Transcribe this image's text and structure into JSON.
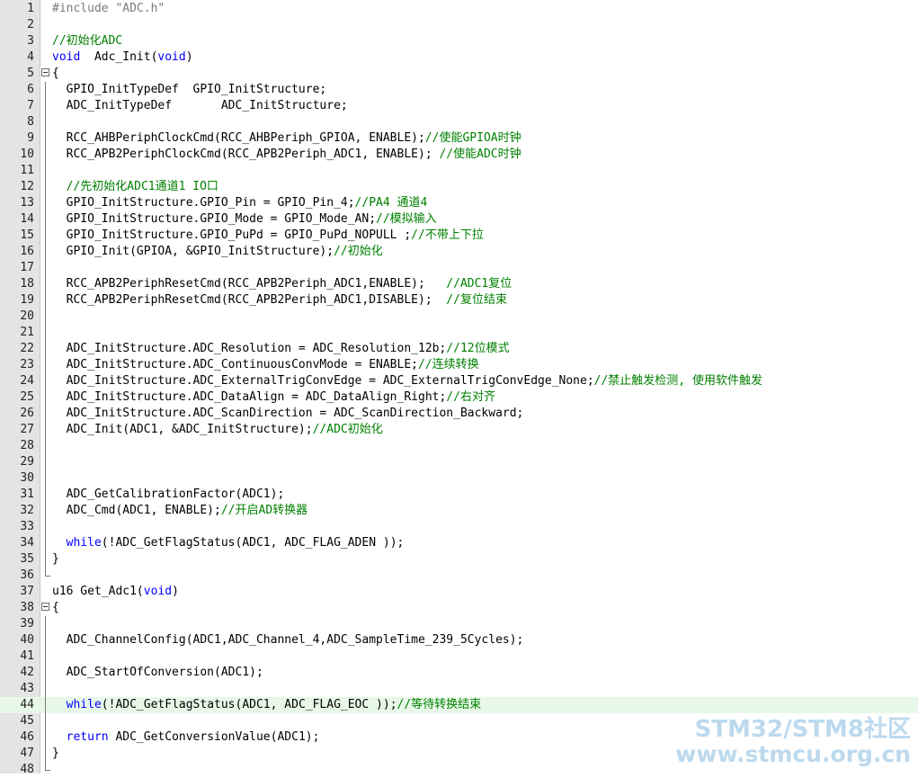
{
  "colors": {
    "gutter_bg": "#e4e4e4",
    "keyword": "#0000ff",
    "comment": "#008000",
    "preprocessor": "#7a7a7a",
    "current_line": "#e8f8e8",
    "watermark": "#bcd9ee"
  },
  "editor": {
    "current_line_number": 44,
    "lines": [
      {
        "n": "1",
        "fold": "",
        "tokens": [
          {
            "t": "#include \"ADC.h\"",
            "c": "pre"
          }
        ]
      },
      {
        "n": "2",
        "fold": "",
        "tokens": []
      },
      {
        "n": "3",
        "fold": "",
        "tokens": [
          {
            "t": "//初始化ADC",
            "c": "cmt"
          }
        ]
      },
      {
        "n": "4",
        "fold": "",
        "tokens": [
          {
            "t": "void",
            "c": "kw"
          },
          {
            "t": "  Adc_Init(",
            "c": "id"
          },
          {
            "t": "void",
            "c": "kw"
          },
          {
            "t": ")",
            "c": "id"
          }
        ]
      },
      {
        "n": "5",
        "fold": "start",
        "tokens": [
          {
            "t": "{",
            "c": "id"
          }
        ]
      },
      {
        "n": "6",
        "fold": "line",
        "tokens": [
          {
            "t": "  GPIO_InitTypeDef  GPIO_InitStructure;",
            "c": "id"
          }
        ]
      },
      {
        "n": "7",
        "fold": "line",
        "tokens": [
          {
            "t": "  ADC_InitTypeDef       ADC_InitStructure;",
            "c": "id"
          }
        ]
      },
      {
        "n": "8",
        "fold": "line",
        "tokens": []
      },
      {
        "n": "9",
        "fold": "line",
        "tokens": [
          {
            "t": "  RCC_AHBPeriphClockCmd(RCC_AHBPeriph_GPIOA, ENABLE);",
            "c": "id"
          },
          {
            "t": "//使能GPIOA时钟",
            "c": "cmt"
          }
        ]
      },
      {
        "n": "10",
        "fold": "line",
        "tokens": [
          {
            "t": "  RCC_APB2PeriphClockCmd(RCC_APB2Periph_ADC1, ENABLE); ",
            "c": "id"
          },
          {
            "t": "//使能ADC时钟",
            "c": "cmt"
          }
        ]
      },
      {
        "n": "11",
        "fold": "line",
        "tokens": []
      },
      {
        "n": "12",
        "fold": "line",
        "tokens": [
          {
            "t": "  //先初始化ADC1通道1 IO口",
            "c": "cmt"
          }
        ]
      },
      {
        "n": "13",
        "fold": "line",
        "tokens": [
          {
            "t": "  GPIO_InitStructure.GPIO_Pin = GPIO_Pin_4;",
            "c": "id"
          },
          {
            "t": "//PA4 通道4",
            "c": "cmt"
          }
        ]
      },
      {
        "n": "14",
        "fold": "line",
        "tokens": [
          {
            "t": "  GPIO_InitStructure.GPIO_Mode = GPIO_Mode_AN;",
            "c": "id"
          },
          {
            "t": "//模拟输入",
            "c": "cmt"
          }
        ]
      },
      {
        "n": "15",
        "fold": "line",
        "tokens": [
          {
            "t": "  GPIO_InitStructure.GPIO_PuPd = GPIO_PuPd_NOPULL ;",
            "c": "id"
          },
          {
            "t": "//不带上下拉",
            "c": "cmt"
          }
        ]
      },
      {
        "n": "16",
        "fold": "line",
        "tokens": [
          {
            "t": "  GPIO_Init(GPIOA, &GPIO_InitStructure);",
            "c": "id"
          },
          {
            "t": "//初始化",
            "c": "cmt"
          }
        ]
      },
      {
        "n": "17",
        "fold": "line",
        "tokens": []
      },
      {
        "n": "18",
        "fold": "line",
        "tokens": [
          {
            "t": "  RCC_APB2PeriphResetCmd(RCC_APB2Periph_ADC1,ENABLE);   ",
            "c": "id"
          },
          {
            "t": "//ADC1复位",
            "c": "cmt"
          }
        ]
      },
      {
        "n": "19",
        "fold": "line",
        "tokens": [
          {
            "t": "  RCC_APB2PeriphResetCmd(RCC_APB2Periph_ADC1,DISABLE);  ",
            "c": "id"
          },
          {
            "t": "//复位结束",
            "c": "cmt"
          }
        ]
      },
      {
        "n": "20",
        "fold": "line",
        "tokens": []
      },
      {
        "n": "21",
        "fold": "line",
        "tokens": []
      },
      {
        "n": "22",
        "fold": "line",
        "tokens": [
          {
            "t": "  ADC_InitStructure.ADC_Resolution = ADC_Resolution_12b;",
            "c": "id"
          },
          {
            "t": "//12位模式",
            "c": "cmt"
          }
        ]
      },
      {
        "n": "23",
        "fold": "line",
        "tokens": [
          {
            "t": "  ADC_InitStructure.ADC_ContinuousConvMode = ENABLE;",
            "c": "id"
          },
          {
            "t": "//连续转换",
            "c": "cmt"
          }
        ]
      },
      {
        "n": "24",
        "fold": "line",
        "tokens": [
          {
            "t": "  ADC_InitStructure.ADC_ExternalTrigConvEdge = ADC_ExternalTrigConvEdge_None;",
            "c": "id"
          },
          {
            "t": "//禁止触发检测, 使用软件触发",
            "c": "cmt"
          }
        ]
      },
      {
        "n": "25",
        "fold": "line",
        "tokens": [
          {
            "t": "  ADC_InitStructure.ADC_DataAlign = ADC_DataAlign_Right;",
            "c": "id"
          },
          {
            "t": "//右对齐",
            "c": "cmt"
          }
        ]
      },
      {
        "n": "26",
        "fold": "line",
        "tokens": [
          {
            "t": "  ADC_InitStructure.ADC_ScanDirection = ADC_ScanDirection_Backward;",
            "c": "id"
          }
        ]
      },
      {
        "n": "27",
        "fold": "line",
        "tokens": [
          {
            "t": "  ADC_Init(ADC1, &ADC_InitStructure);",
            "c": "id"
          },
          {
            "t": "//ADC初始化",
            "c": "cmt"
          }
        ]
      },
      {
        "n": "28",
        "fold": "line",
        "tokens": []
      },
      {
        "n": "29",
        "fold": "line",
        "tokens": []
      },
      {
        "n": "30",
        "fold": "line",
        "tokens": []
      },
      {
        "n": "31",
        "fold": "line",
        "tokens": [
          {
            "t": "  ADC_GetCalibrationFactor(ADC1);",
            "c": "id"
          }
        ]
      },
      {
        "n": "32",
        "fold": "line",
        "tokens": [
          {
            "t": "  ADC_Cmd(ADC1, ENABLE);",
            "c": "id"
          },
          {
            "t": "//开启AD转换器",
            "c": "cmt"
          }
        ]
      },
      {
        "n": "33",
        "fold": "line",
        "tokens": []
      },
      {
        "n": "34",
        "fold": "line",
        "tokens": [
          {
            "t": "  ",
            "c": "id"
          },
          {
            "t": "while",
            "c": "kw"
          },
          {
            "t": "(!ADC_GetFlagStatus(ADC1, ADC_FLAG_ADEN ));",
            "c": "id"
          }
        ]
      },
      {
        "n": "35",
        "fold": "line",
        "tokens": [
          {
            "t": "}",
            "c": "id"
          }
        ]
      },
      {
        "n": "36",
        "fold": "end",
        "tokens": []
      },
      {
        "n": "37",
        "fold": "",
        "tokens": [
          {
            "t": "u16 Get_Adc1(",
            "c": "id"
          },
          {
            "t": "void",
            "c": "kw"
          },
          {
            "t": ")",
            "c": "id"
          }
        ]
      },
      {
        "n": "38",
        "fold": "start",
        "tokens": [
          {
            "t": "{",
            "c": "id"
          }
        ]
      },
      {
        "n": "39",
        "fold": "line",
        "tokens": []
      },
      {
        "n": "40",
        "fold": "line",
        "tokens": [
          {
            "t": "  ADC_ChannelConfig(ADC1,ADC_Channel_4,ADC_SampleTime_239_5Cycles);",
            "c": "id"
          }
        ]
      },
      {
        "n": "41",
        "fold": "line",
        "tokens": []
      },
      {
        "n": "42",
        "fold": "line",
        "tokens": [
          {
            "t": "  ADC_StartOfConversion(ADC1);",
            "c": "id"
          }
        ]
      },
      {
        "n": "43",
        "fold": "line",
        "tokens": []
      },
      {
        "n": "44",
        "fold": "line",
        "tokens": [
          {
            "t": "  ",
            "c": "id"
          },
          {
            "t": "while",
            "c": "kw"
          },
          {
            "t": "(!ADC_GetFlagStatus(ADC1, ADC_FLAG_EOC ));",
            "c": "id"
          },
          {
            "t": "//等待转换结束",
            "c": "cmt"
          }
        ]
      },
      {
        "n": "45",
        "fold": "line",
        "tokens": []
      },
      {
        "n": "46",
        "fold": "line",
        "tokens": [
          {
            "t": "  ",
            "c": "id"
          },
          {
            "t": "return",
            "c": "kw"
          },
          {
            "t": " ADC_GetConversionValue(ADC1);",
            "c": "id"
          }
        ]
      },
      {
        "n": "47",
        "fold": "line",
        "tokens": [
          {
            "t": "}",
            "c": "id"
          }
        ]
      },
      {
        "n": "48",
        "fold": "end",
        "tokens": []
      }
    ]
  },
  "watermark": {
    "line1": "STM32/STM8社区",
    "line2": "www.stmcu.org.cn"
  }
}
